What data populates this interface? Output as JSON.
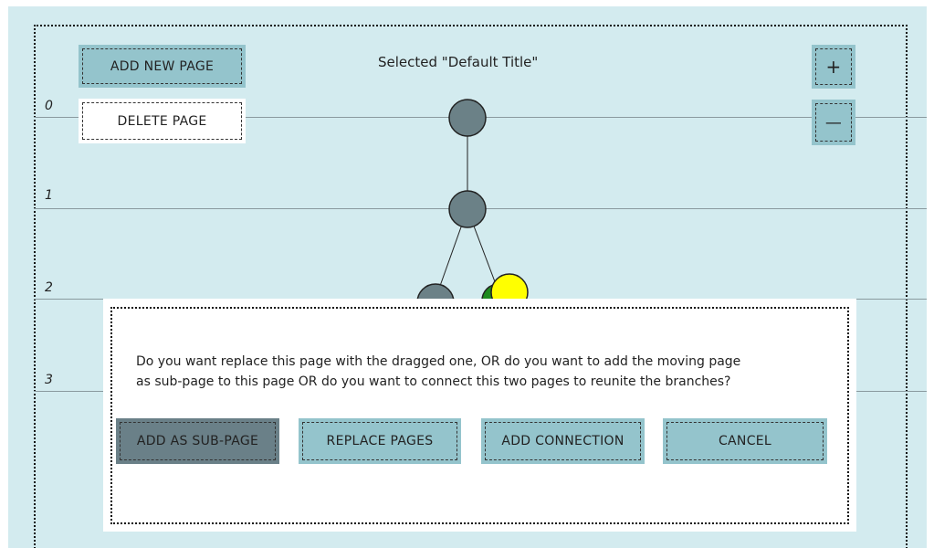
{
  "header": {
    "selected_title": "Selected \"Default Title\""
  },
  "toolbar": {
    "add_new_page_label": "ADD NEW PAGE",
    "delete_page_label": "DELETE PAGE",
    "zoom_in_label": "+",
    "zoom_out_label": "—"
  },
  "levels": [
    "0",
    "1",
    "2",
    "3"
  ],
  "tree": {
    "node_colors": {
      "default": "#6b8187",
      "green": "#1e8a1e",
      "yellow": "#ffff00"
    }
  },
  "dialog": {
    "message_line1": "Do you want replace this page with the dragged one, OR do you want to add the moving page",
    "message_line2": "as sub-page to this page OR do you want to connect this two pages to reunite the branches?",
    "buttons": {
      "add_sub_page": "ADD AS SUB-PAGE",
      "replace_pages": "REPLACE PAGES",
      "add_connection": "ADD CONNECTION",
      "cancel": "CANCEL"
    }
  },
  "colors": {
    "canvas_bg": "#d3ebef",
    "button_blue": "#94c4cc",
    "button_dark": "#6a8088"
  }
}
